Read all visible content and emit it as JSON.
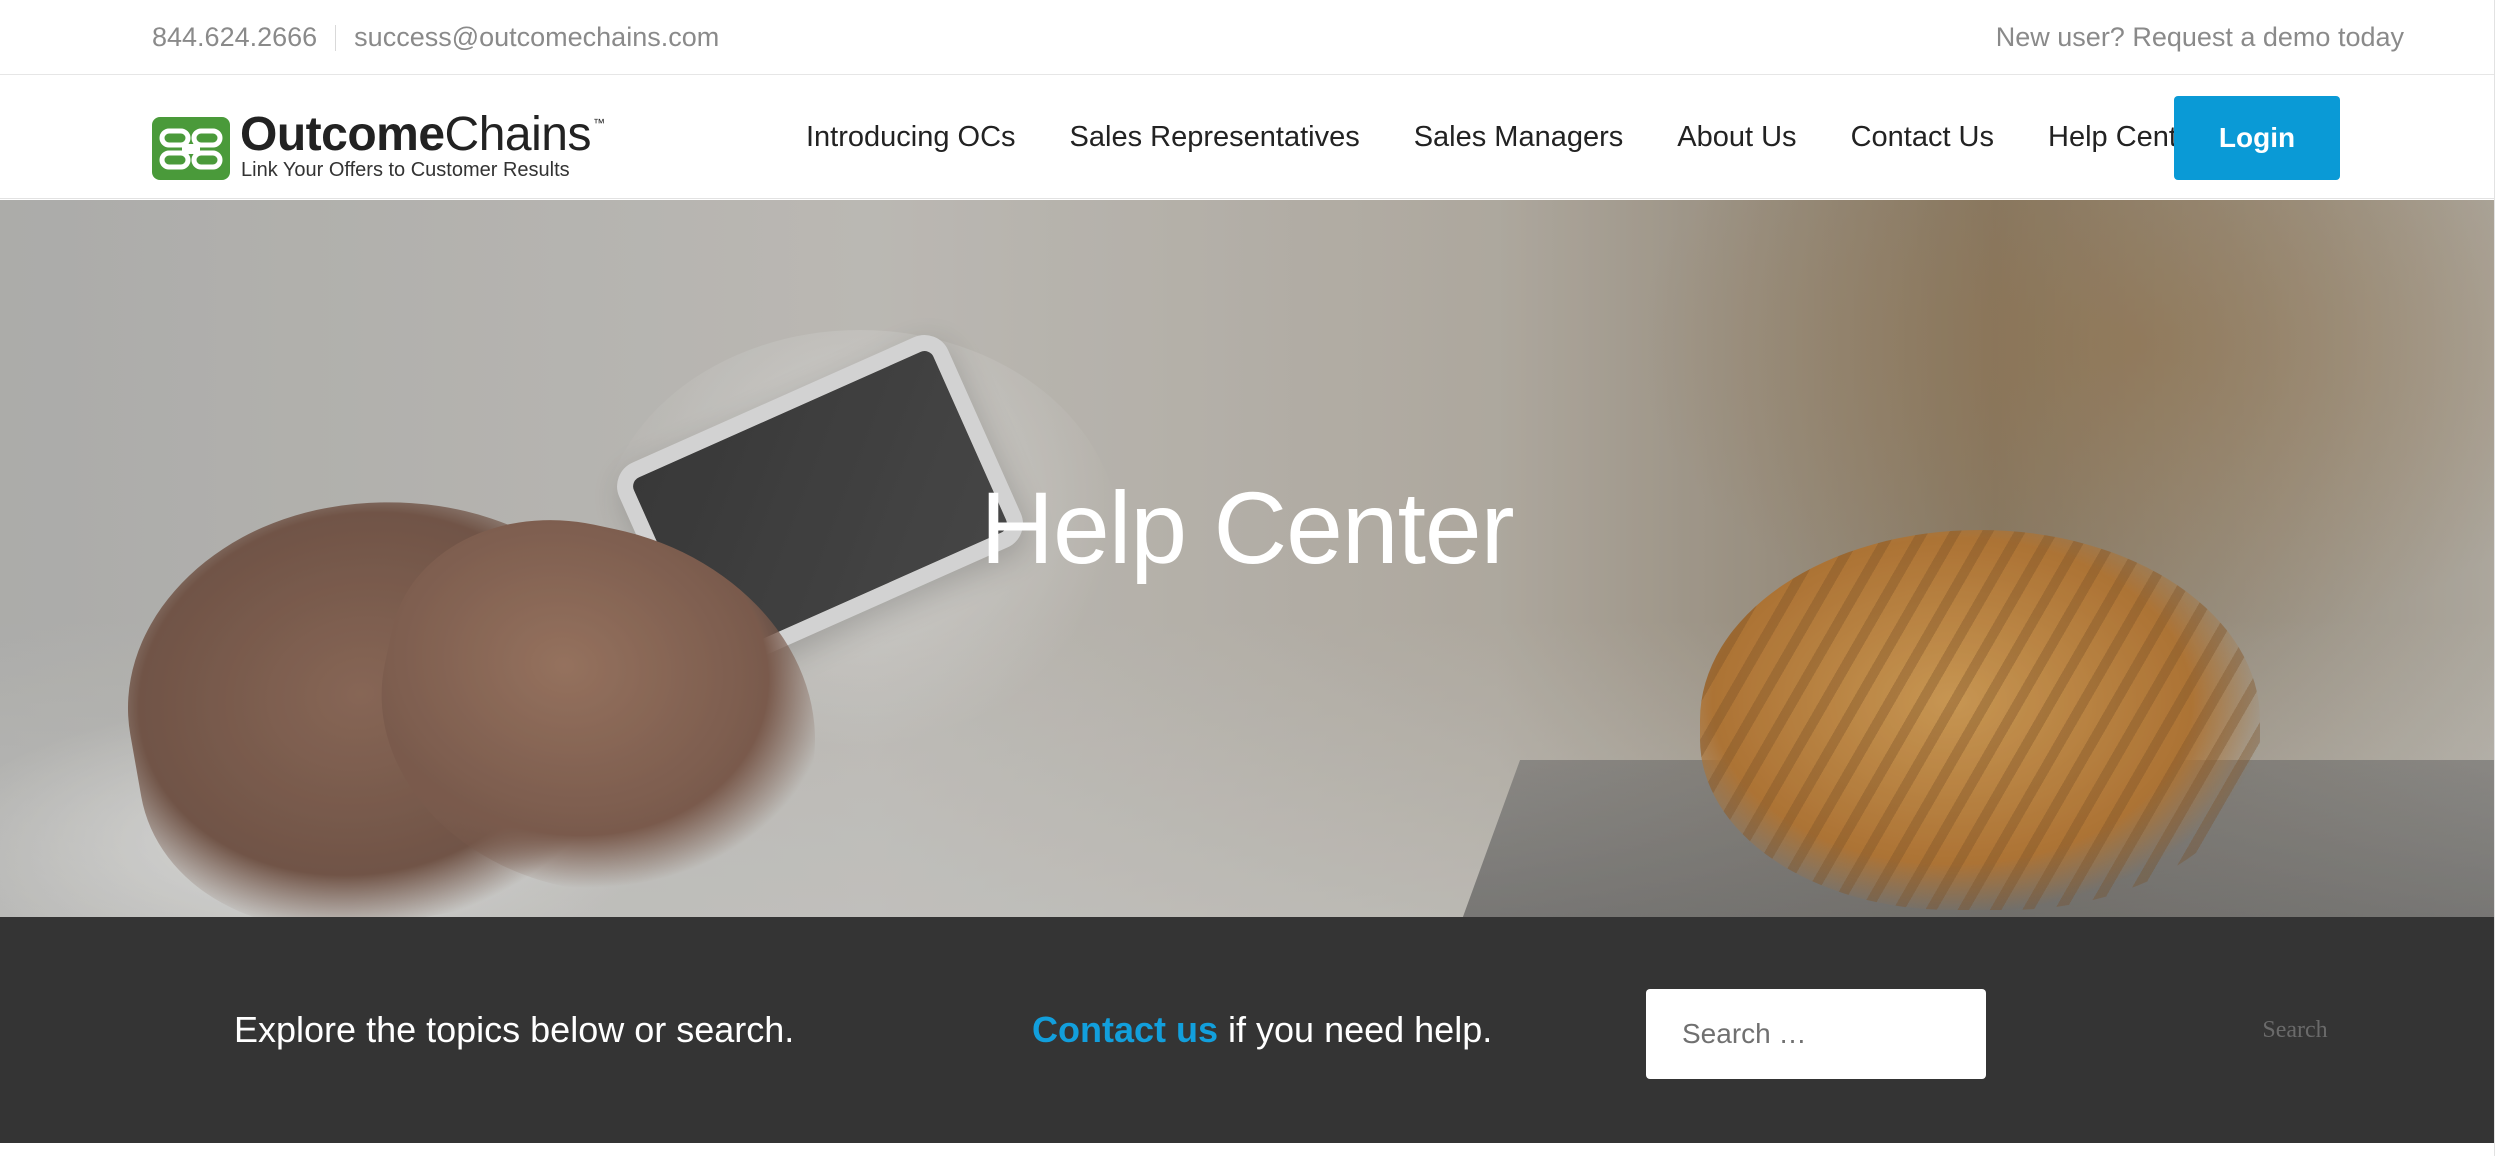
{
  "topbar": {
    "phone": "844.624.2666",
    "email": "success@outcomechains.com",
    "demo_link": "New user? Request a demo today"
  },
  "logo": {
    "word_bold": "Outcome",
    "word_light": "Chains",
    "trademark": "™",
    "tagline": "Link Your Offers to Customer Results",
    "brand_color": "#4a9a3a"
  },
  "nav": {
    "items": [
      {
        "label": "Introducing OCs"
      },
      {
        "label": "Sales Representatives"
      },
      {
        "label": "Sales Managers"
      },
      {
        "label": "About Us"
      },
      {
        "label": "Contact Us"
      },
      {
        "label": "Help Center"
      }
    ],
    "login_label": "Login",
    "accent_color": "#0a9ad6"
  },
  "hero": {
    "title": "Help Center"
  },
  "helpbar": {
    "explore_text": "Explore the topics below or search.",
    "contact_link": "Contact us",
    "contact_suffix": "if you need help.",
    "search_placeholder": "Search …",
    "search_button": "Search"
  }
}
